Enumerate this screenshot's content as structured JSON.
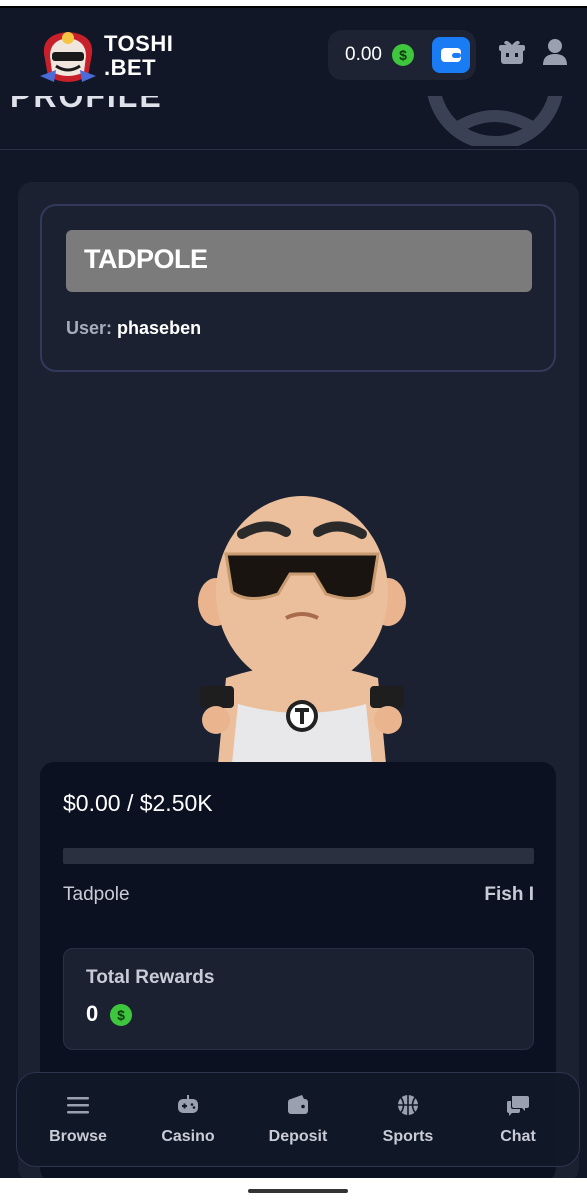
{
  "header": {
    "logo_line1": "TOSHI",
    "logo_line2": ".BET",
    "balance": "0.00",
    "currency_symbol": "$",
    "icons": [
      "wallet-icon",
      "gift-icon",
      "user-icon"
    ]
  },
  "banner": {
    "title": "PROFILE"
  },
  "profile": {
    "rank": "TADPOLE",
    "user_label": "User:",
    "username": "phaseben"
  },
  "progress": {
    "amount_text": "$0.00 / $2.50K",
    "fraction": 0,
    "current_level": "Tadpole",
    "next_level": "Fish I"
  },
  "rewards": {
    "title": "Total Rewards",
    "value": "0",
    "currency_symbol": "$"
  },
  "nav": {
    "items": [
      {
        "label": "Browse",
        "icon": "menu-icon"
      },
      {
        "label": "Casino",
        "icon": "gamepad-icon"
      },
      {
        "label": "Deposit",
        "icon": "wallet-icon"
      },
      {
        "label": "Sports",
        "icon": "basketball-icon"
      },
      {
        "label": "Chat",
        "icon": "chat-icon"
      }
    ]
  },
  "colors": {
    "background": "#111726",
    "card": "#1b2131",
    "accent_blue": "#1a7cf5",
    "coin_green": "#3ec73e",
    "rank_bar": "#7b7b7b"
  }
}
